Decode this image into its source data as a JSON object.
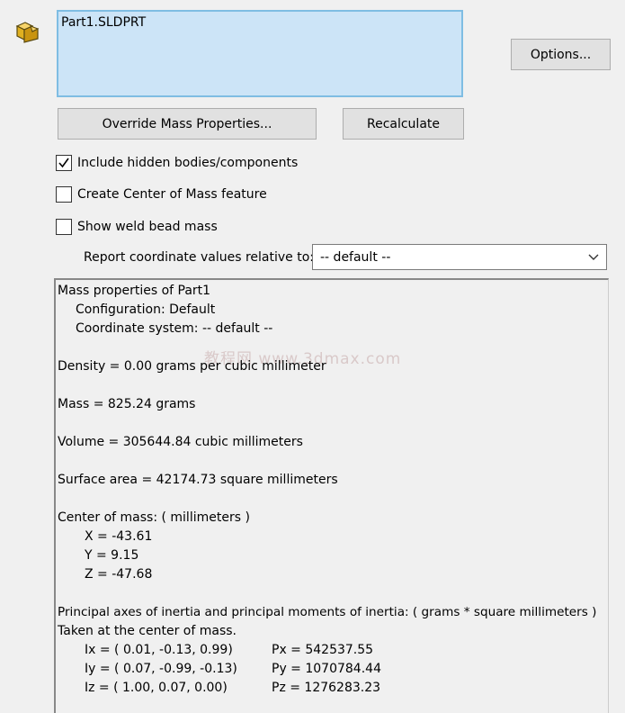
{
  "selection": {
    "items": [
      "Part1.SLDPRT"
    ]
  },
  "buttons": {
    "options": "Options...",
    "override": "Override Mass Properties...",
    "recalculate": "Recalculate"
  },
  "checkboxes": [
    {
      "label": "Include hidden bodies/components",
      "checked": true
    },
    {
      "label": "Create Center of Mass feature",
      "checked": false
    },
    {
      "label": "Show weld bead mass",
      "checked": false
    }
  ],
  "report": {
    "label": "Report coordinate values relative to:",
    "selected": "-- default --"
  },
  "results": {
    "title": "Mass properties of Part1",
    "configuration": "Configuration: Default",
    "coordinate_system": "Coordinate system: -- default --",
    "watermark": "教程网 www.3dmax.com",
    "density": "Density = 0.00 grams per cubic millimeter",
    "mass": "Mass = 825.24 grams",
    "volume": "Volume = 305644.84 cubic millimeters",
    "surface_area": "Surface area = 42174.73  square millimeters",
    "com_header": "Center of mass: ( millimeters )",
    "com_x": "X = -43.61",
    "com_y": "Y = 9.15",
    "com_z": "Z = -47.68",
    "principal_header": "Principal axes of inertia and principal moments of inertia: ( grams *  square millimeters )",
    "principal_sub": "Taken at the center of mass.",
    "ix": "Ix = ( 0.01, -0.13,  0.99)",
    "iy": "Iy = ( 0.07, -0.99, -0.13)",
    "iz": "Iz = ( 1.00,  0.07,  0.00)",
    "pxv": "Px = 542537.55",
    "pyv": "Py = 1070784.44",
    "pzv": "Pz = 1276283.23"
  },
  "icons": {
    "part": "part-icon",
    "dropdown": "chevron-down-icon",
    "check": "checkmark-icon"
  }
}
